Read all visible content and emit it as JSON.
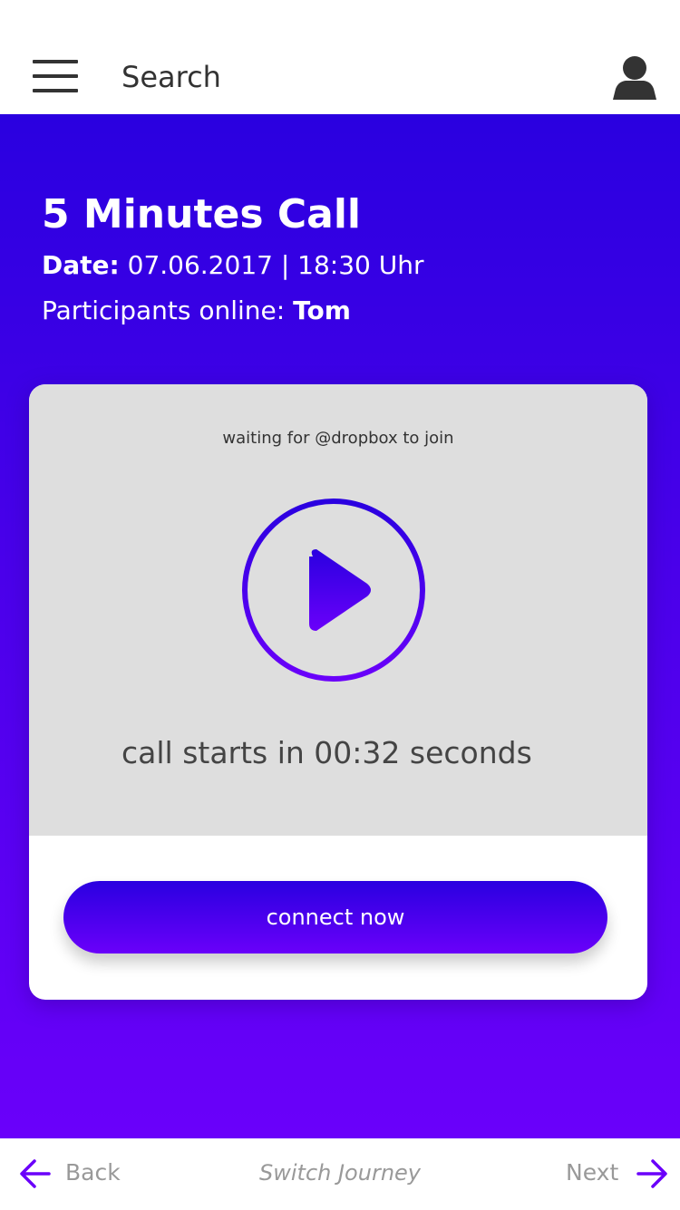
{
  "header": {
    "menu_icon": "hamburger-menu-icon",
    "search_label": "Search",
    "profile_icon": "user-avatar-icon"
  },
  "call": {
    "title": "5 Minutes Call",
    "date_label": "Date:",
    "date_value": "07.06.2017 | 18:30 Uhr",
    "participants_label": "Participants online:",
    "participants_value": "Tom"
  },
  "card": {
    "waiting_text": "waiting for @dropbox to join",
    "play_icon": "play-icon",
    "countdown_text": "call starts in 00:32 seconds",
    "connect_label": "connect now"
  },
  "footer": {
    "back_label": "Back",
    "switch_label": "Switch Journey",
    "next_label": "Next",
    "back_icon": "arrow-left-icon",
    "next_icon": "arrow-right-icon"
  },
  "colors": {
    "accent_start": "#2a00e0",
    "accent_end": "#6a00fa",
    "card_background": "#dedede",
    "muted_text": "#999999"
  }
}
